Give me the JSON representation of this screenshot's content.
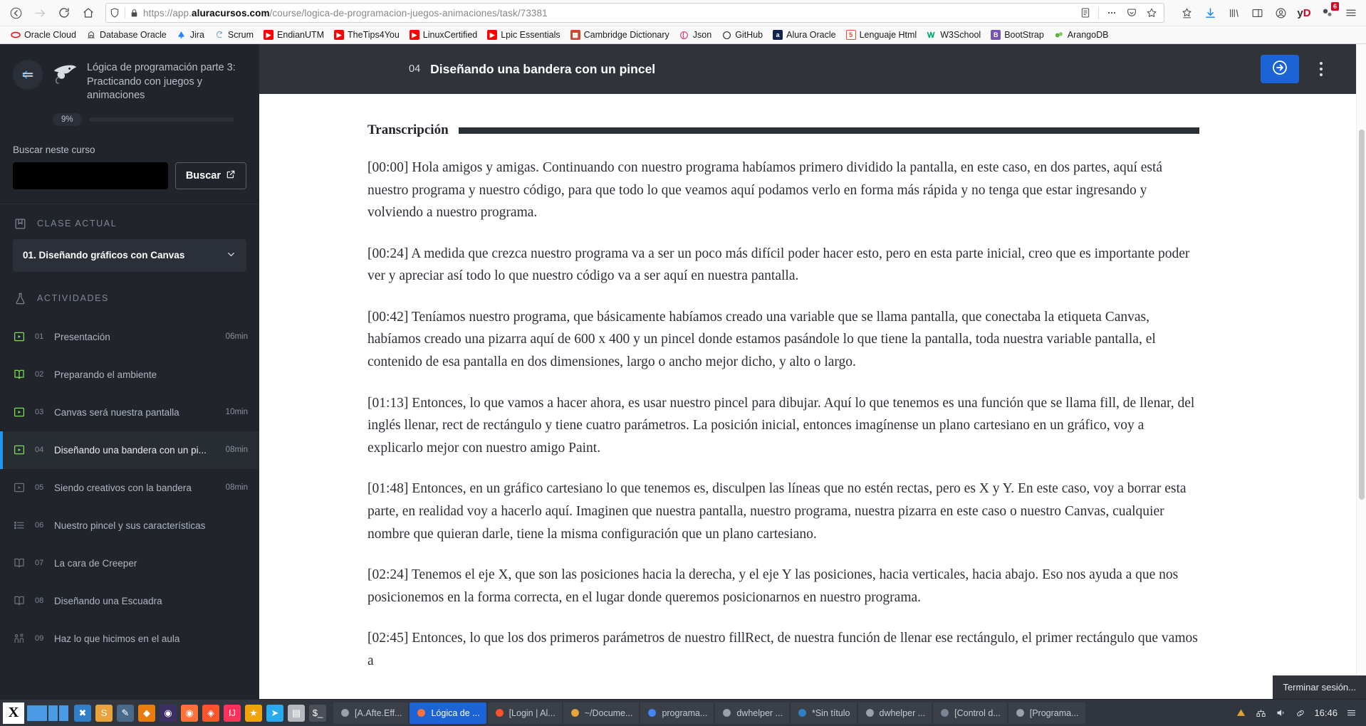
{
  "browser": {
    "nav": {
      "back_icon": "arrow-left-icon",
      "forward_icon": "arrow-right-icon",
      "reload_icon": "reload-icon",
      "home_icon": "home-icon"
    },
    "url": {
      "prefix": "https://app.",
      "domain": "aluracursos.com",
      "path": "/course/logica-de-programacion-juegos-animaciones/task/73381",
      "shield_icon": "shield-icon",
      "lock_icon": "padlock-icon",
      "reader_icon": "reader-view-icon",
      "more_icon": "ellipsis-icon",
      "pocket_icon": "pocket-icon",
      "star_icon": "star-outline-icon"
    },
    "toolbar_right": [
      {
        "name": "bookmark-star-icon",
        "label": ""
      },
      {
        "name": "download-icon",
        "label": ""
      },
      {
        "name": "library-icon",
        "label": ""
      },
      {
        "name": "sidebar-icon",
        "label": ""
      },
      {
        "name": "account-icon",
        "label": ""
      },
      {
        "name": "yandex-disk-icon",
        "label": "yD"
      },
      {
        "name": "extension-icon",
        "label": "",
        "badge": "6"
      },
      {
        "name": "hamburger-menu-icon",
        "label": ""
      }
    ],
    "bookmarks": [
      {
        "label": "Oracle Cloud",
        "icon": "oracle-icon",
        "color": "#f80000"
      },
      {
        "label": "Database Oracle",
        "icon": "database-icon",
        "color": "#555555"
      },
      {
        "label": "Jira",
        "icon": "jira-icon",
        "color": "#2684ff"
      },
      {
        "label": "Scrum",
        "icon": "scrum-icon",
        "color": "#6fa8b5"
      },
      {
        "label": "EndianUTM",
        "icon": "youtube-icon",
        "color": "#ff0000"
      },
      {
        "label": "TheTips4You",
        "icon": "youtube-icon",
        "color": "#ff0000"
      },
      {
        "label": "LinuxCertified",
        "icon": "youtube-icon",
        "color": "#ff0000"
      },
      {
        "label": "Lpic Essentials",
        "icon": "youtube-icon",
        "color": "#ff0000"
      },
      {
        "label": "Cambridge Dictionary",
        "icon": "cambridge-icon",
        "color": "#d1442f"
      },
      {
        "label": "Json",
        "icon": "json-icon",
        "color": "#e2336b"
      },
      {
        "label": "GitHub",
        "icon": "github-icon",
        "color": "#1b1f23"
      },
      {
        "label": "Alura Oracle",
        "icon": "alura-icon",
        "color": "#10224e"
      },
      {
        "label": "Lenguaje Html",
        "icon": "html5-icon",
        "color": "#e44d26"
      },
      {
        "label": "W3School",
        "icon": "w3school-icon",
        "color": "#04aa6d"
      },
      {
        "label": "BootStrap",
        "icon": "bootstrap-icon",
        "color": "#7952b3"
      },
      {
        "label": "ArangoDB",
        "icon": "arangodb-icon",
        "color": "#5bb639"
      }
    ]
  },
  "sidebar": {
    "back_icon": "back-to-course-icon",
    "course_logo_icon": "alura-mascot-icon",
    "course_title": "Lógica de programación parte 3: Practicando con juegos y animaciones",
    "progress_percent": "9%",
    "progress_value": 9,
    "progress_fill_color": "#7ddc5a",
    "search": {
      "label": "Buscar neste curso",
      "input_value": "",
      "input_placeholder": "",
      "button_label": "Buscar",
      "button_icon": "external-link-icon"
    },
    "current_section": {
      "heading": "CLASE ACTUAL",
      "heading_icon": "book-icon",
      "selected": "01. Diseñando gráficos con Canvas",
      "chevron_icon": "chevron-down-icon"
    },
    "activities_section": {
      "heading": "ACTIVIDADES",
      "heading_icon": "flask-icon"
    },
    "activities": [
      {
        "num": "01",
        "label": "Presentación",
        "duration": "06min",
        "icon": "video-icon",
        "state": "done",
        "active": false
      },
      {
        "num": "02",
        "label": "Preparando el ambiente",
        "duration": "",
        "icon": "book-icon",
        "state": "done",
        "active": false
      },
      {
        "num": "03",
        "label": "Canvas será nuestra pantalla",
        "duration": "10min",
        "icon": "video-icon",
        "state": "done",
        "active": false
      },
      {
        "num": "04",
        "label": "Diseñando una bandera con un pi...",
        "duration": "08min",
        "icon": "video-icon",
        "state": "done",
        "active": true
      },
      {
        "num": "05",
        "label": "Siendo creativos con la bandera",
        "duration": "08min",
        "icon": "video-icon",
        "state": "pending",
        "active": false
      },
      {
        "num": "06",
        "label": "Nuestro pincel y sus características",
        "duration": "",
        "icon": "list-icon",
        "state": "pending",
        "active": false
      },
      {
        "num": "07",
        "label": "La cara de Creeper",
        "duration": "",
        "icon": "book-icon",
        "state": "pending",
        "active": false
      },
      {
        "num": "08",
        "label": "Diseñando una Escuadra",
        "duration": "",
        "icon": "book-icon",
        "state": "pending",
        "active": false
      },
      {
        "num": "09",
        "label": "Haz lo que hicimos en el aula",
        "duration": "",
        "icon": "people-icon",
        "state": "pending",
        "active": false
      }
    ],
    "accent_active_color": "#2196f3",
    "done_icon_color": "#7ddc5a"
  },
  "main": {
    "header": {
      "lesson_number": "04",
      "lesson_title": "Diseñando una bandera con un pincel",
      "next_button_icon": "arrow-right-circle-icon",
      "next_button_color": "#1c63d5",
      "menu_icon": "kebab-menu-icon"
    },
    "transcript": {
      "title": "Transcripción",
      "paragraphs": [
        "[00:00] Hola amigos y amigas. Continuando con nuestro programa habíamos primero dividido la pantalla, en este caso, en dos partes, aquí está nuestro programa y nuestro código, para que todo lo que veamos aquí podamos verlo en forma más rápida y no tenga que estar ingresando y volviendo a nuestro programa.",
        "[00:24] A medida que crezca nuestro programa va a ser un poco más difícil poder hacer esto, pero en esta parte inicial, creo que es importante poder ver y apreciar así todo lo que nuestro código va a ser aquí en nuestra pantalla.",
        "[00:42] Teníamos nuestro programa, que básicamente habíamos creado una variable que se llama pantalla, que conectaba la etiqueta Canvas, habíamos creado una pizarra aquí de 600 x 400 y un pincel donde estamos pasándole lo que tiene la pantalla, toda nuestra variable pantalla, el contenido de esa pantalla en dos dimensiones, largo o ancho mejor dicho, y alto o largo.",
        "[01:13] Entonces, lo que vamos a hacer ahora, es usar nuestro pincel para dibujar. Aquí lo que tenemos es una función que se llama fill, de llenar, del inglés llenar, rect de rectángulo y tiene cuatro parámetros. La posición inicial, entonces imagínense un plano cartesiano en un gráfico, voy a explicarlo mejor con nuestro amigo Paint.",
        "[01:48] Entonces, en un gráfico cartesiano lo que tenemos es, disculpen las líneas que no estén rectas, pero es X y Y. En este caso, voy a borrar esta parte, en realidad voy a hacerlo aquí. Imaginen que nuestra pantalla, nuestro programa, nuestra pizarra en este caso o nuestro Canvas, cualquier nombre que quieran darle, tiene la misma configuración que un plano cartesiano.",
        "[02:24] Tenemos el eje X, que son las posiciones hacia la derecha, y el eje Y las posiciones, hacia verticales, hacia abajo. Eso nos ayuda a que nos posicionemos en la forma correcta, en el lugar donde queremos posicionarnos en nuestro programa.",
        "[02:45] Entonces, lo que los dos primeros parámetros de nuestro fillRect, de nuestra función de llenar ese rectángulo, el primer rectángulo que vamos a"
      ]
    },
    "logout_toast": "Terminar sesión..."
  },
  "taskbar": {
    "start_label": "X",
    "launchers": [
      {
        "name": "vscode-icon",
        "color": "#2f80c9",
        "glyph": "✖"
      },
      {
        "name": "sublime-icon",
        "color": "#e8a33d",
        "glyph": "S"
      },
      {
        "name": "tool-icon",
        "color": "#4a6a8a",
        "glyph": "✎"
      },
      {
        "name": "blender-icon",
        "color": "#e87d0d",
        "glyph": "◆"
      },
      {
        "name": "ellipse-icon",
        "color": "#3b2f63",
        "glyph": "◉"
      },
      {
        "name": "firefox-icon",
        "color": "#ff7139",
        "glyph": "◉"
      },
      {
        "name": "brave-icon",
        "color": "#fb542b",
        "glyph": "◈"
      },
      {
        "name": "intellij-icon",
        "color": "#fe315d",
        "glyph": "IJ"
      },
      {
        "name": "star-icon",
        "color": "#f0a30a",
        "glyph": "★"
      },
      {
        "name": "telegram-icon",
        "color": "#2aabee",
        "glyph": "➤"
      },
      {
        "name": "files-icon",
        "color": "#b5b8bd",
        "glyph": "▤"
      },
      {
        "name": "terminal-icon",
        "color": "#4b4f57",
        "glyph": "$_"
      }
    ],
    "windows": [
      {
        "label": "[A.Afte.Eff...",
        "icon": "blank-icon",
        "active": false
      },
      {
        "label": "Lógica de ...",
        "icon": "firefox-icon",
        "active": true
      },
      {
        "label": "[Login | Al...",
        "icon": "brave-icon",
        "active": false
      },
      {
        "label": "~/Docume...",
        "icon": "sublime-icon",
        "active": false
      },
      {
        "label": "programa...",
        "icon": "chrome-icon",
        "active": false
      },
      {
        "label": "dwhelper ...",
        "icon": "blank-icon",
        "active": false
      },
      {
        "label": "*Sin título",
        "icon": "editor-icon",
        "active": false
      },
      {
        "label": "dwhelper ...",
        "icon": "blank-icon",
        "active": false
      },
      {
        "label": "[Control d...",
        "icon": "settings-icon",
        "active": false
      },
      {
        "label": "[Programa...",
        "icon": "blank-icon",
        "active": false
      }
    ],
    "tray": [
      {
        "name": "updates-icon",
        "glyph": "▲"
      },
      {
        "name": "network-icon",
        "glyph": "🖧"
      },
      {
        "name": "volume-icon",
        "glyph": "🔊"
      },
      {
        "name": "link-icon",
        "glyph": "🔗"
      }
    ],
    "clock": "16:46",
    "menu_icon": "hamburger-icon"
  }
}
